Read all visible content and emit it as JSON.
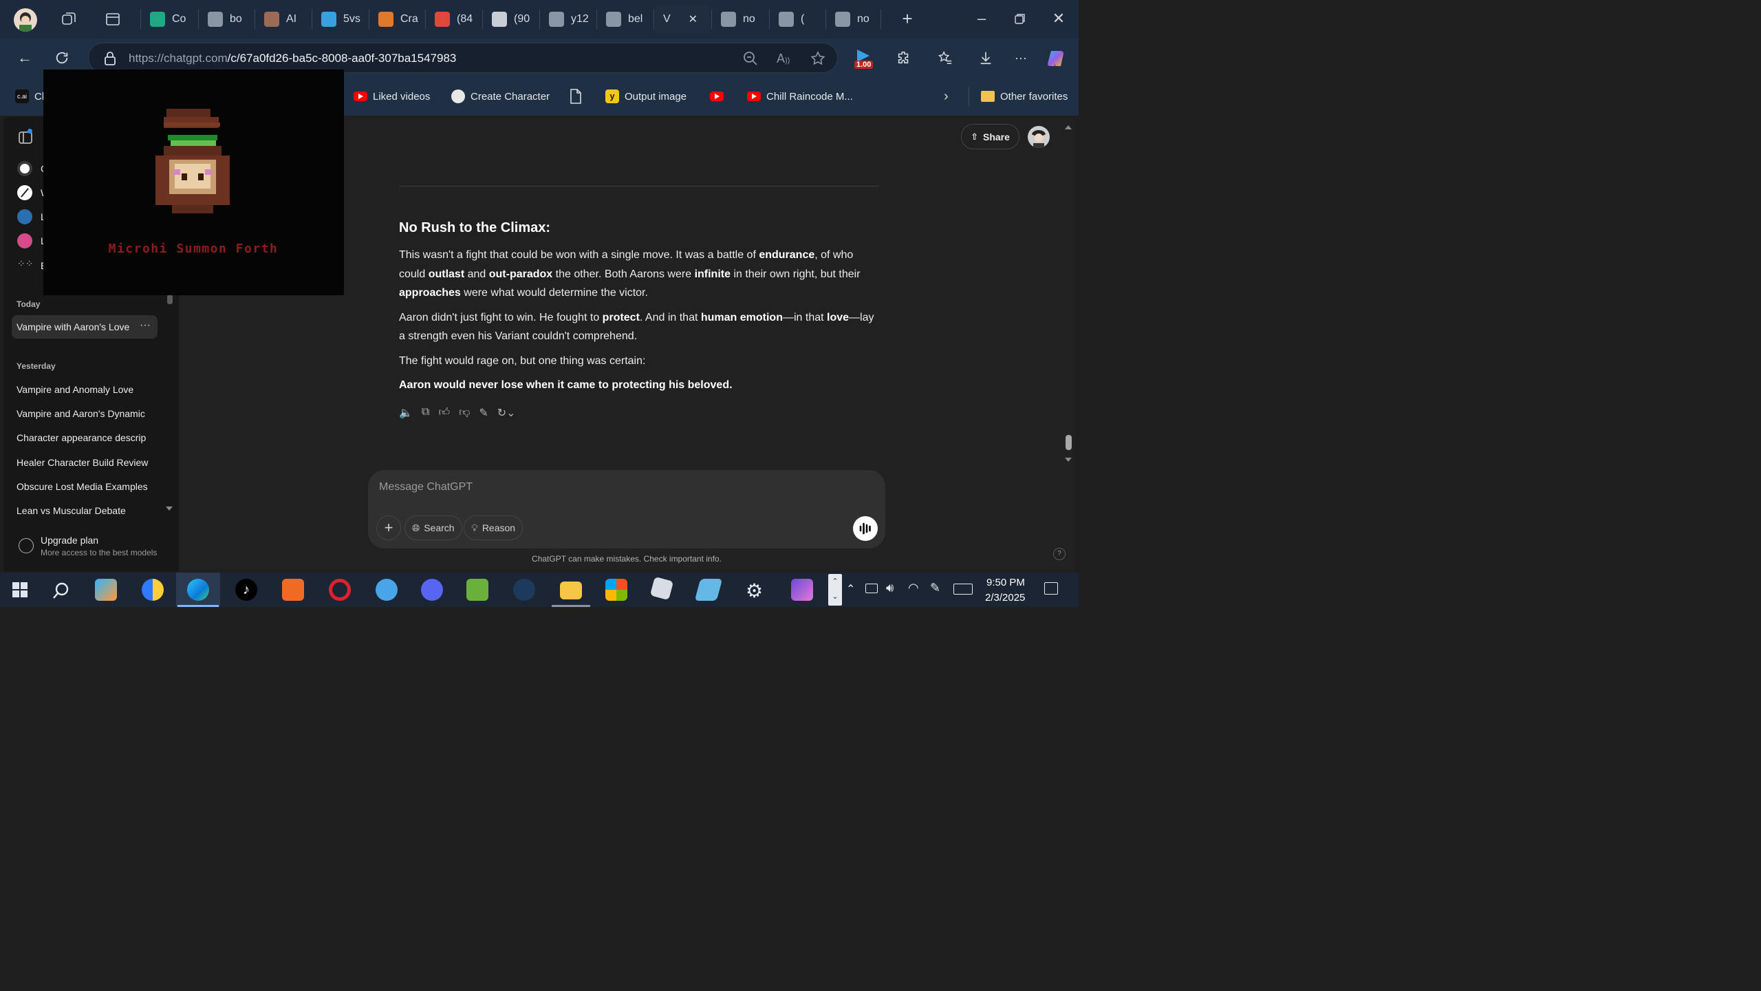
{
  "browser": {
    "tabs": [
      {
        "label": "Co",
        "color": "#20a884"
      },
      {
        "label": "bo",
        "color": "#8a95a5"
      },
      {
        "label": "AI",
        "color": "#9b6b55"
      },
      {
        "label": "5vs",
        "color": "#3aa0e0"
      },
      {
        "label": "Cra",
        "color": "#e07a2a"
      },
      {
        "label": "(84",
        "color": "#e0483a"
      },
      {
        "label": "(90",
        "color": "#c9ced6"
      },
      {
        "label": "y12",
        "color": "#8a95a5"
      },
      {
        "label": "bel",
        "color": "#8a95a5"
      },
      {
        "label": "V",
        "color": "#202c3f"
      },
      {
        "label": "no",
        "color": "#8a95a5"
      },
      {
        "label": "(",
        "color": "#8a95a5"
      },
      {
        "label": "no",
        "color": "#8a95a5"
      }
    ],
    "active_tab_index": 9,
    "url_host": "https://chatgpt.com",
    "url_path": "/c/67a0fd26-ba5c-8008-aa0f-307ba1547983",
    "extension_badge": "1.00",
    "favorites": [
      {
        "label": "Cl",
        "icon": "character-ai-icon"
      },
      {
        "label": "Liked videos",
        "icon": "youtube-icon"
      },
      {
        "label": "Create Character",
        "icon": "character-icon"
      },
      {
        "label": "",
        "icon": "page-icon"
      },
      {
        "label": "Output image",
        "icon": "yellow-app-icon"
      },
      {
        "label": "",
        "icon": "youtube-icon"
      },
      {
        "label": "Chill Raincode M...",
        "icon": "youtube-icon"
      },
      {
        "label": "Other favorites",
        "icon": "folder-icon"
      }
    ]
  },
  "sidebar": {
    "top_items": [
      "C",
      "W",
      "L",
      "L",
      "E"
    ],
    "today_label": "Today",
    "today_items": [
      {
        "label": "Vampire with Aaron's Love"
      }
    ],
    "yesterday_label": "Yesterday",
    "yesterday_items": [
      {
        "label": "Vampire and Anomaly Love"
      },
      {
        "label": "Vampire and Aaron's Dynamic"
      },
      {
        "label": "Character appearance descrip"
      },
      {
        "label": "Healer Character Build Review"
      },
      {
        "label": "Obscure Lost Media Examples"
      },
      {
        "label": "Lean vs Muscular Debate"
      }
    ],
    "upgrade_title": "Upgrade plan",
    "upgrade_subtitle": "More access to the best models"
  },
  "header": {
    "share_label": "Share"
  },
  "message": {
    "heading": "No Rush to the Climax:",
    "p1": [
      {
        "t": "This wasn't a fight that could be won with a single move. It was a battle of ",
        "b": false
      },
      {
        "t": "endurance",
        "b": true
      },
      {
        "t": ", of who could ",
        "b": false
      },
      {
        "t": "outlast",
        "b": true
      },
      {
        "t": " and ",
        "b": false
      },
      {
        "t": "out-paradox",
        "b": true
      },
      {
        "t": " the other. Both Aarons were ",
        "b": false
      },
      {
        "t": "infinite",
        "b": true
      },
      {
        "t": " in their own right, but their ",
        "b": false
      },
      {
        "t": "approaches",
        "b": true
      },
      {
        "t": " were what would determine the victor.",
        "b": false
      }
    ],
    "p2": [
      {
        "t": "Aaron didn't just fight to win. He fought to ",
        "b": false
      },
      {
        "t": "protect",
        "b": true
      },
      {
        "t": ". And in that ",
        "b": false
      },
      {
        "t": "human emotion",
        "b": true
      },
      {
        "t": "—in that ",
        "b": false
      },
      {
        "t": "love",
        "b": true
      },
      {
        "t": "—lay a strength even his Variant couldn't comprehend.",
        "b": false
      }
    ],
    "p3": "The fight would rage on, but one thing was certain:",
    "p4": "Aaron would never lose when it came to protecting his beloved."
  },
  "composer": {
    "placeholder": "Message ChatGPT",
    "search_label": "Search",
    "reason_label": "Reason",
    "disclaimer": "ChatGPT can make mistakes. Check important info.",
    "help": "?"
  },
  "overlay": {
    "caption": "Microhi Summon Forth",
    "caption_color": "#8b1d1d"
  },
  "taskbar": {
    "time": "9:50 PM",
    "date": "2/3/2025"
  }
}
